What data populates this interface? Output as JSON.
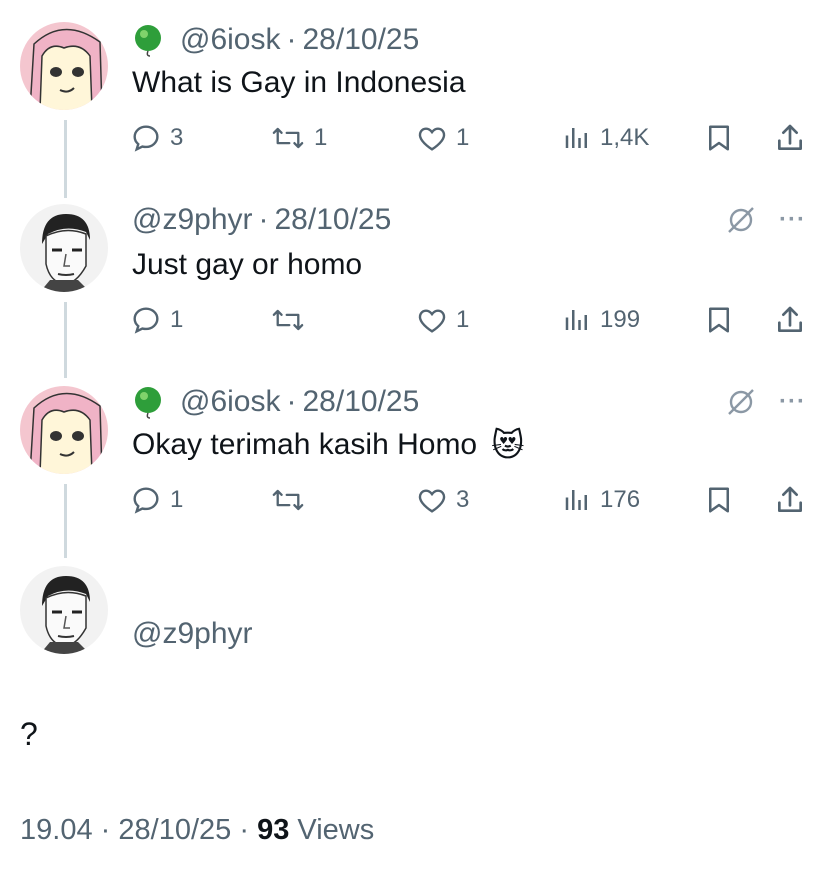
{
  "tweets": [
    {
      "handle": "@6iosk",
      "date": "28/10/25",
      "text": "What is Gay in Indonesia",
      "emoji": "",
      "replies": "3",
      "reposts": "1",
      "likes": "1",
      "views": "1,4K"
    },
    {
      "handle": "@z9phyr",
      "date": "28/10/25",
      "text": "Just gay or homo",
      "emoji": "",
      "replies": "1",
      "reposts": "",
      "likes": "1",
      "views": "199"
    },
    {
      "handle": "@6iosk",
      "date": "28/10/25",
      "text": "Okay terimah kasih Homo",
      "emoji": "😻",
      "replies": "1",
      "reposts": "",
      "likes": "3",
      "views": "176"
    }
  ],
  "main_tweet": {
    "handle": "@z9phyr",
    "text": "?",
    "time": "19.04",
    "date": "28/10/25",
    "views_count": "93",
    "views_label": "Views"
  },
  "separator": "·",
  "more_label": "···",
  "colors": {
    "text_primary": "#0f1419",
    "text_secondary": "#536471",
    "thread_line": "#cfd9de",
    "badge_green": "#2e9e3a"
  },
  "icons": [
    "reply-icon",
    "repost-icon",
    "like-icon",
    "views-icon",
    "bookmark-icon",
    "share-icon",
    "grok-icon",
    "more-icon",
    "green-badge-icon"
  ]
}
